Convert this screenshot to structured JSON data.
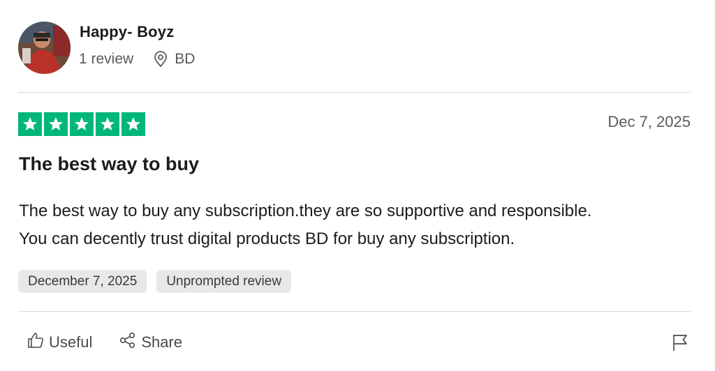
{
  "reviewer": {
    "name": "Happy- Boyz",
    "review_count": "1 review",
    "location": "BD"
  },
  "review": {
    "rating": 5,
    "rating_max": 5,
    "date": "Dec 7, 2025",
    "title": "The best way to buy",
    "body_line1": "The best way to buy any subscription.they are so supportive and responsible.",
    "body_line2": "You can decently trust digital products BD for buy any subscription.",
    "tags": [
      "December 7, 2025",
      "Unprompted review"
    ]
  },
  "actions": {
    "useful_label": "Useful",
    "share_label": "Share",
    "flag_icon": "flag-icon"
  },
  "icons": {
    "avatar": "avatar-photo",
    "location": "location-pin-icon",
    "star": "star-icon",
    "useful": "thumbs-up-icon",
    "share": "share-icon"
  },
  "colors": {
    "star_green": "#00b67a",
    "tag_bg": "#e8e8e8",
    "muted_text": "#5a5a5a"
  }
}
